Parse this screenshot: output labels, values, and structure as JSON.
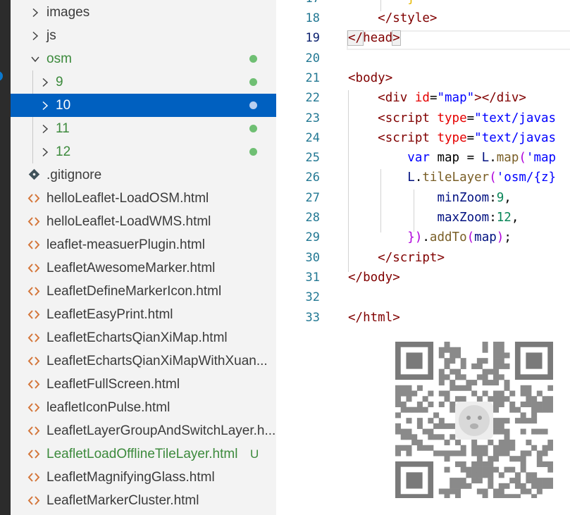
{
  "explorer": {
    "items": [
      {
        "label": "images",
        "kind": "folder",
        "expanded": false
      },
      {
        "label": "js",
        "kind": "folder",
        "expanded": false
      },
      {
        "label": "osm",
        "kind": "folder",
        "expanded": true,
        "modified": true
      },
      {
        "label": "9",
        "kind": "folder",
        "expanded": false,
        "modified": true
      },
      {
        "label": "10",
        "kind": "folder",
        "expanded": false,
        "modified": true,
        "selected": true
      },
      {
        "label": "11",
        "kind": "folder",
        "expanded": false,
        "modified": true
      },
      {
        "label": "12",
        "kind": "folder",
        "expanded": false,
        "modified": true
      },
      {
        "label": ".gitignore",
        "kind": "gitignore"
      },
      {
        "label": "helloLeaflet-LoadOSM.html",
        "kind": "html"
      },
      {
        "label": "helloLeaflet-LoadWMS.html",
        "kind": "html"
      },
      {
        "label": "leaflet-measuerPlugin.html",
        "kind": "html"
      },
      {
        "label": "LeafletAwesomeMarker.html",
        "kind": "html"
      },
      {
        "label": "LeafletDefineMarkerIcon.html",
        "kind": "html"
      },
      {
        "label": "LeafletEasyPrint.html",
        "kind": "html"
      },
      {
        "label": "LeafletEchartsQianXiMap.html",
        "kind": "html"
      },
      {
        "label": "LeafletEchartsQianXiMapWithXuan...",
        "kind": "html"
      },
      {
        "label": "LeafletFullScreen.html",
        "kind": "html"
      },
      {
        "label": "leafletIconPulse.html",
        "kind": "html"
      },
      {
        "label": "LeafletLayerGroupAndSwitchLayer.h...",
        "kind": "html"
      },
      {
        "label": "LeafletLoadOfflineTileLayer.html",
        "kind": "html",
        "untracked": true,
        "badge": "U"
      },
      {
        "label": "LeafletMagnifyingGlass.html",
        "kind": "html"
      },
      {
        "label": "LeafletMarkerCluster.html",
        "kind": "html"
      }
    ]
  },
  "editor": {
    "partial_top_line": "17",
    "current_line": "19",
    "lines": [
      {
        "num": "18",
        "tokens": [
          [
            "    ",
            "punc"
          ],
          [
            "</",
            "tag"
          ],
          [
            "style",
            "tag"
          ],
          [
            ">",
            "tag"
          ]
        ]
      },
      {
        "num": "19",
        "tokens": [
          [
            "</",
            "tag"
          ],
          [
            "head",
            "tag"
          ],
          [
            ">",
            "tag"
          ]
        ]
      },
      {
        "num": "20",
        "tokens": []
      },
      {
        "num": "21",
        "tokens": [
          [
            "<",
            "tag"
          ],
          [
            "body",
            "tag"
          ],
          [
            ">",
            "tag"
          ]
        ]
      },
      {
        "num": "22",
        "tokens": [
          [
            "    ",
            "punc"
          ],
          [
            "<",
            "tag"
          ],
          [
            "div",
            "tag"
          ],
          [
            " ",
            "punc"
          ],
          [
            "id",
            "attr"
          ],
          [
            "=",
            "punc"
          ],
          [
            "\"map\"",
            "str"
          ],
          [
            "></",
            "tag"
          ],
          [
            "div",
            "tag"
          ],
          [
            ">",
            "tag"
          ]
        ]
      },
      {
        "num": "23",
        "tokens": [
          [
            "    ",
            "punc"
          ],
          [
            "<",
            "tag"
          ],
          [
            "script",
            "tag"
          ],
          [
            " ",
            "punc"
          ],
          [
            "type",
            "attr"
          ],
          [
            "=",
            "punc"
          ],
          [
            "\"text/javas",
            "str"
          ]
        ]
      },
      {
        "num": "24",
        "tokens": [
          [
            "    ",
            "punc"
          ],
          [
            "<",
            "tag"
          ],
          [
            "script",
            "tag"
          ],
          [
            " ",
            "punc"
          ],
          [
            "type",
            "attr"
          ],
          [
            "=",
            "punc"
          ],
          [
            "\"text/javas",
            "str"
          ]
        ]
      },
      {
        "num": "25",
        "tokens": [
          [
            "        ",
            "punc"
          ],
          [
            "var",
            "kw"
          ],
          [
            " map = ",
            "punc"
          ],
          [
            "L",
            "prop"
          ],
          [
            ".",
            "punc"
          ],
          [
            "map",
            "fn"
          ],
          [
            "(",
            "brace"
          ],
          [
            "'map",
            "str"
          ]
        ]
      },
      {
        "num": "26",
        "tokens": [
          [
            "        ",
            "punc"
          ],
          [
            "L",
            "prop"
          ],
          [
            ".",
            "punc"
          ],
          [
            "tileLayer",
            "fn"
          ],
          [
            "(",
            "brace"
          ],
          [
            "'osm/{z}",
            "str"
          ]
        ]
      },
      {
        "num": "27",
        "tokens": [
          [
            "            ",
            "punc"
          ],
          [
            "minZoom",
            "prop"
          ],
          [
            ":",
            "punc"
          ],
          [
            "9",
            "num"
          ],
          [
            ",",
            "punc"
          ]
        ]
      },
      {
        "num": "28",
        "tokens": [
          [
            "            ",
            "punc"
          ],
          [
            "maxZoom",
            "prop"
          ],
          [
            ":",
            "punc"
          ],
          [
            "12",
            "num"
          ],
          [
            ",",
            "punc"
          ]
        ]
      },
      {
        "num": "29",
        "tokens": [
          [
            "        ",
            "punc"
          ],
          [
            "})",
            "brace"
          ],
          [
            ".",
            "punc"
          ],
          [
            "addTo",
            "fn"
          ],
          [
            "(",
            "brace"
          ],
          [
            "map",
            "prop"
          ],
          [
            ")",
            "brace"
          ],
          [
            ";",
            "punc"
          ]
        ]
      },
      {
        "num": "30",
        "tokens": [
          [
            "    ",
            "punc"
          ],
          [
            "</",
            "tag"
          ],
          [
            "script",
            "tag"
          ],
          [
            ">",
            "tag"
          ]
        ]
      },
      {
        "num": "31",
        "tokens": [
          [
            "</",
            "tag"
          ],
          [
            "body",
            "tag"
          ],
          [
            ">",
            "tag"
          ]
        ]
      },
      {
        "num": "32",
        "tokens": []
      },
      {
        "num": "33",
        "tokens": [
          [
            "</",
            "tag"
          ],
          [
            "html",
            "tag"
          ],
          [
            ">",
            "tag"
          ]
        ]
      }
    ],
    "partial_top_code": "}"
  },
  "colors": {
    "selected_bg": "#0060c0",
    "modified_dot": "#6fbf73",
    "untracked_text": "#3c8a3c",
    "html_icon": "#d4763a"
  },
  "overlay": {
    "qr_code": "qr-code-image"
  }
}
